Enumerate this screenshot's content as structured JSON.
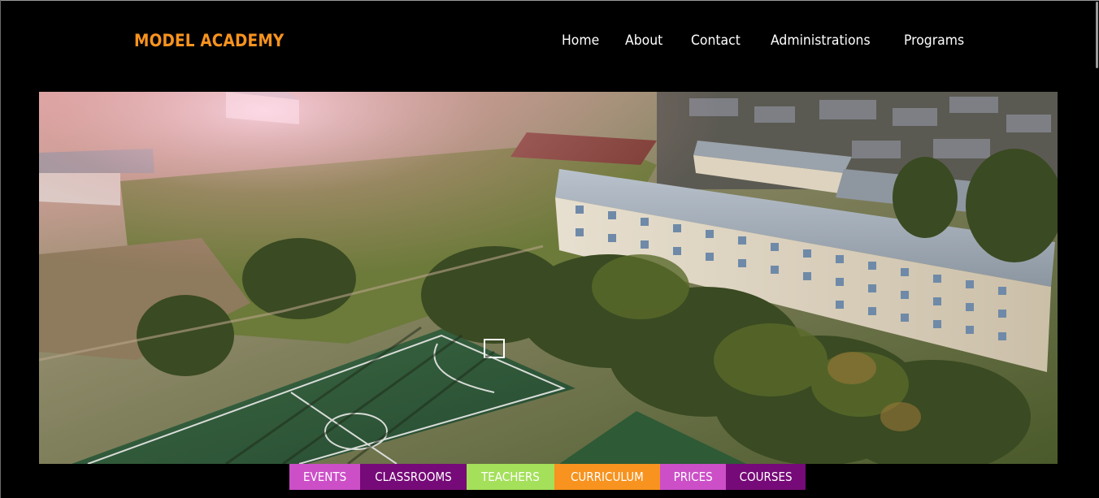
{
  "brand": {
    "name": "MODEL ACADEMY",
    "color": "#f7931e"
  },
  "nav": {
    "items": [
      "Home",
      "About",
      "Contact",
      "Administrations",
      "Programs"
    ]
  },
  "hero": {
    "image_description_icon": "school-campus-aerial-photo"
  },
  "tabs": [
    {
      "label": "EVENTS",
      "bg": "#cc4fc8",
      "color": "#ffffff"
    },
    {
      "label": "CLASSROOMS",
      "bg": "#760a78",
      "color": "#ffffff"
    },
    {
      "label": "TEACHERS",
      "bg": "#a4e05a",
      "color": "#ffffff"
    },
    {
      "label": "CURRICULUM",
      "bg": "#f7931e",
      "color": "#ffffff"
    },
    {
      "label": "PRICES",
      "bg": "#cc4fc8",
      "color": "#ffffff"
    },
    {
      "label": "COURSES",
      "bg": "#760a78",
      "color": "#ffffff"
    }
  ]
}
